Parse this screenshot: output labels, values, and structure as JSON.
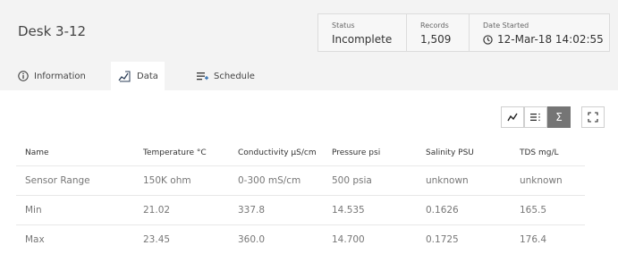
{
  "header": {
    "title": "Desk 3-12",
    "stats": [
      {
        "label": "Status",
        "value": "Incomplete"
      },
      {
        "label": "Records",
        "value": "1,509"
      },
      {
        "label": "Date Started",
        "value": "12-Mar-18 14:02:55"
      }
    ]
  },
  "tabs": [
    {
      "label": "Information",
      "icon": "info-icon"
    },
    {
      "label": "Data",
      "icon": "chart-line-icon",
      "active": true
    },
    {
      "label": "Schedule",
      "icon": "list-add-icon"
    }
  ],
  "toolbar": {
    "buttons": [
      {
        "icon": "line-chart-icon"
      },
      {
        "icon": "list-icon"
      },
      {
        "icon": "sigma-icon",
        "active": true
      },
      {
        "icon": "expand-icon"
      }
    ]
  },
  "table": {
    "columns": [
      "Name",
      "Temperature °C",
      "Conductivity µS/cm",
      "Pressure psi",
      "Salinity PSU",
      "TDS mg/L"
    ],
    "rows": [
      [
        "Sensor Range",
        "150K ohm",
        "0-300 mS/cm",
        "500 psia",
        "unknown",
        "unknown"
      ],
      [
        "Min",
        "21.02",
        "337.8",
        "14.535",
        "0.1626",
        "165.5"
      ],
      [
        "Max",
        "23.45",
        "360.0",
        "14.700",
        "0.1725",
        "176.4"
      ]
    ]
  },
  "colors": {
    "header_bg": "#f3f3f3",
    "active_toggle": "#757575"
  }
}
